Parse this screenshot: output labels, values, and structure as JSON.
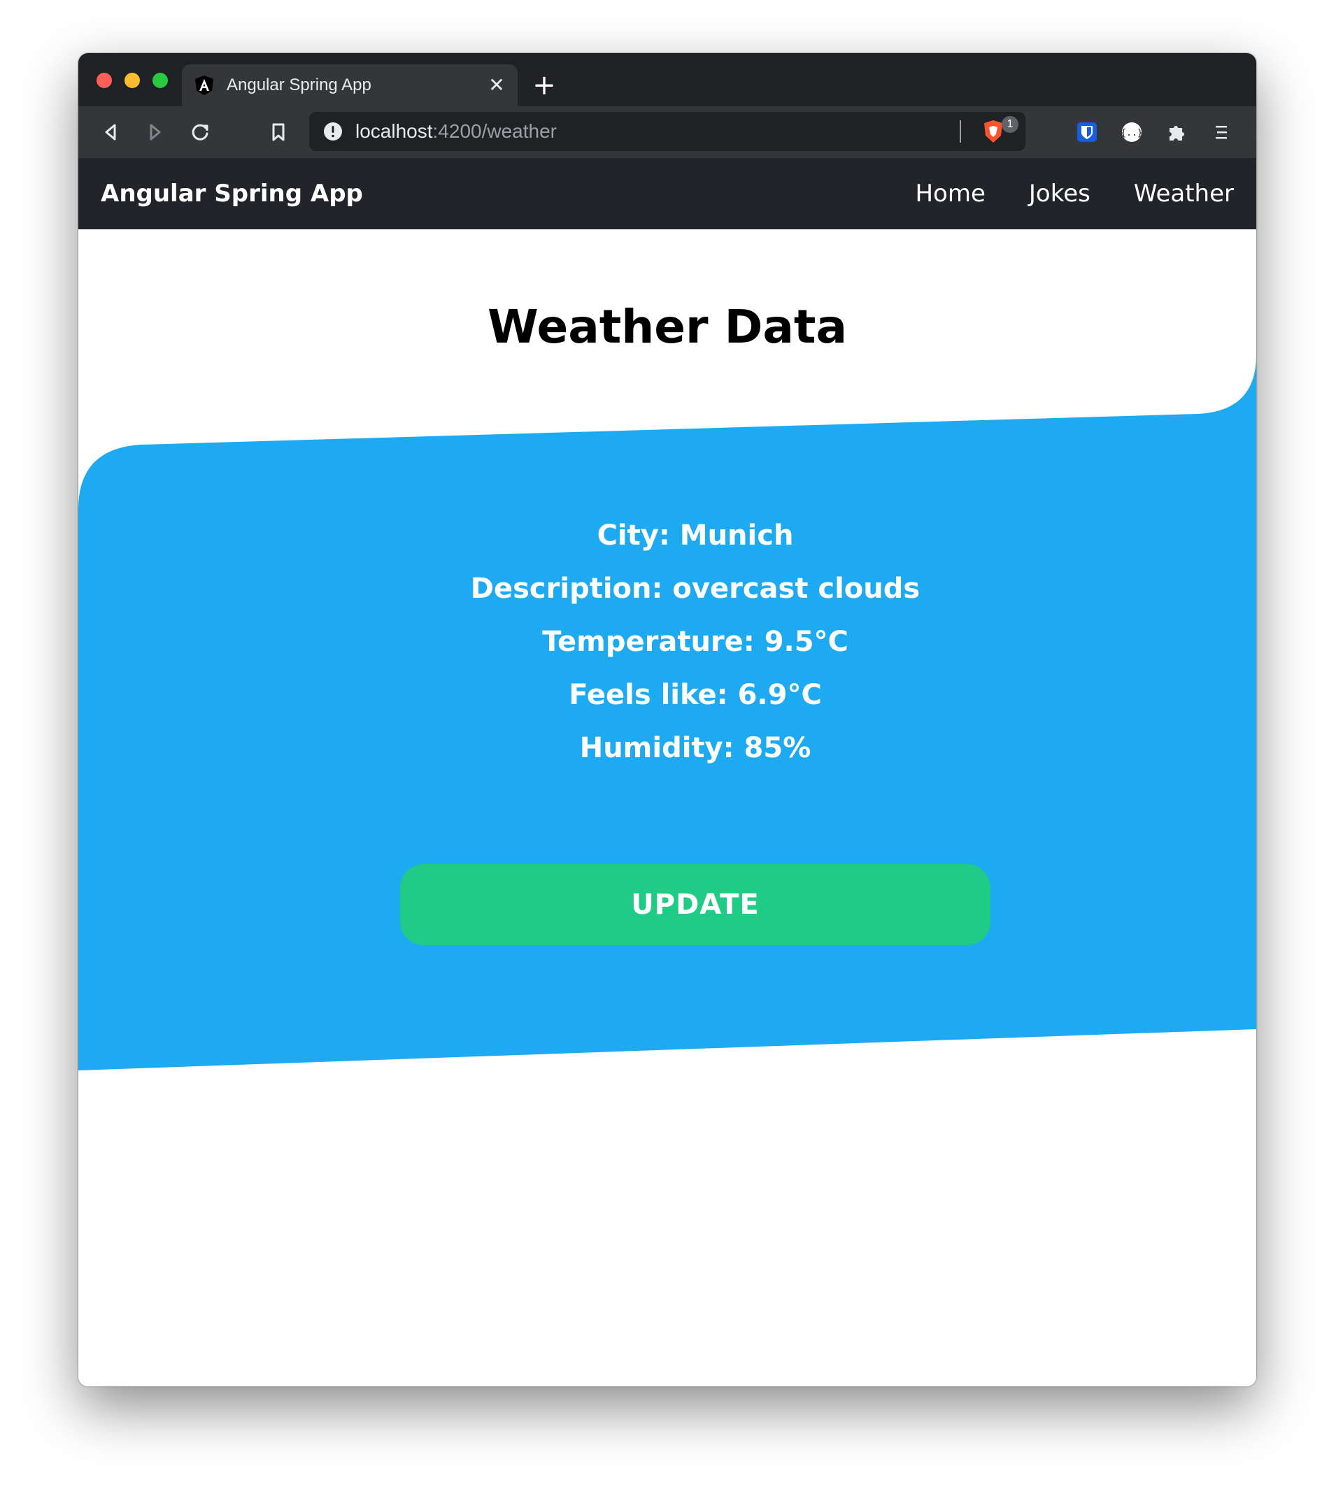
{
  "browser": {
    "tab_title": "Angular Spring App",
    "url_host": "localhost",
    "url_rest": ":4200/weather",
    "shield_badge": "1",
    "icons": [
      "back-icon",
      "forward-icon",
      "reload-icon",
      "bookmark-icon",
      "info-icon",
      "brave-shield-icon",
      "bitwarden-icon",
      "extension-icon",
      "puzzle-icon",
      "menu-icon"
    ]
  },
  "navbar": {
    "brand": "Angular Spring App",
    "links": [
      "Home",
      "Jokes",
      "Weather"
    ]
  },
  "main": {
    "title": "Weather Data",
    "weather": {
      "city": "City: Munich",
      "description": "Description: overcast clouds",
      "temperature": "Temperature: 9.5°C",
      "feels_like": "Feels like: 6.9°C",
      "humidity": "Humidity: 85%"
    },
    "update_label": "UPDATE"
  },
  "colors": {
    "navbar": "#212529",
    "wave": "#1eaaf1",
    "button": "#20cc85",
    "tab_bar": "#202124",
    "toolbar": "#35363a"
  }
}
